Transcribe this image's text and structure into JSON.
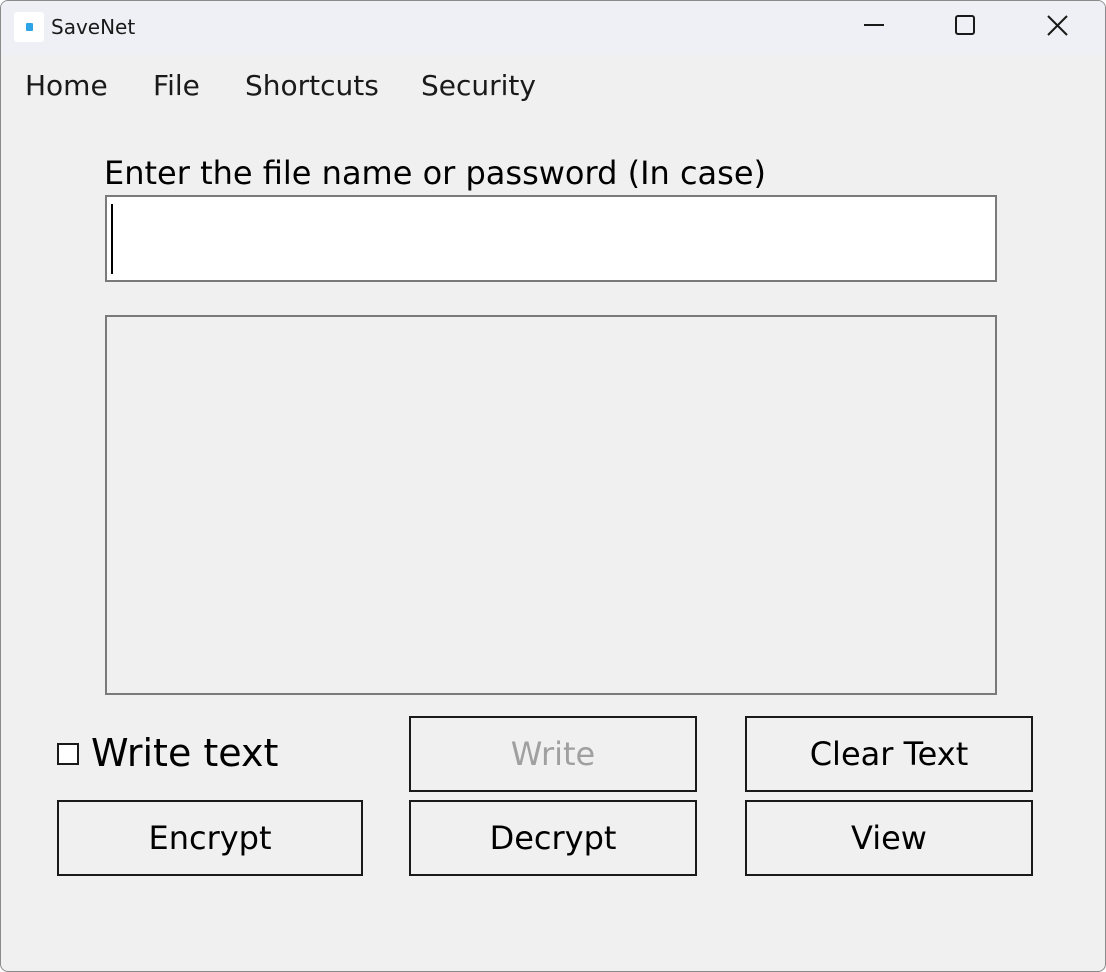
{
  "window": {
    "title": "SaveNet",
    "icon": "app-icon",
    "controls": [
      "minimize-icon",
      "maximize-icon",
      "close-icon"
    ]
  },
  "menu": {
    "items": [
      "Home",
      "File",
      "Shortcuts",
      "Security"
    ]
  },
  "form": {
    "prompt_label": "Enter the file name or password (In case)",
    "input_value": "",
    "textarea_value": ""
  },
  "options": {
    "write_text_label": "Write text",
    "write_text_checked": false
  },
  "buttons": {
    "write": "Write",
    "clear_text": "Clear Text",
    "encrypt": "Encrypt",
    "decrypt": "Decrypt",
    "view": "View"
  },
  "colors": {
    "window_bg": "#f0f0f0",
    "titlebar_bg": "#eff0f5",
    "disabled_text": "#a0a0a0",
    "icon_accent": "#2ea4e8"
  }
}
